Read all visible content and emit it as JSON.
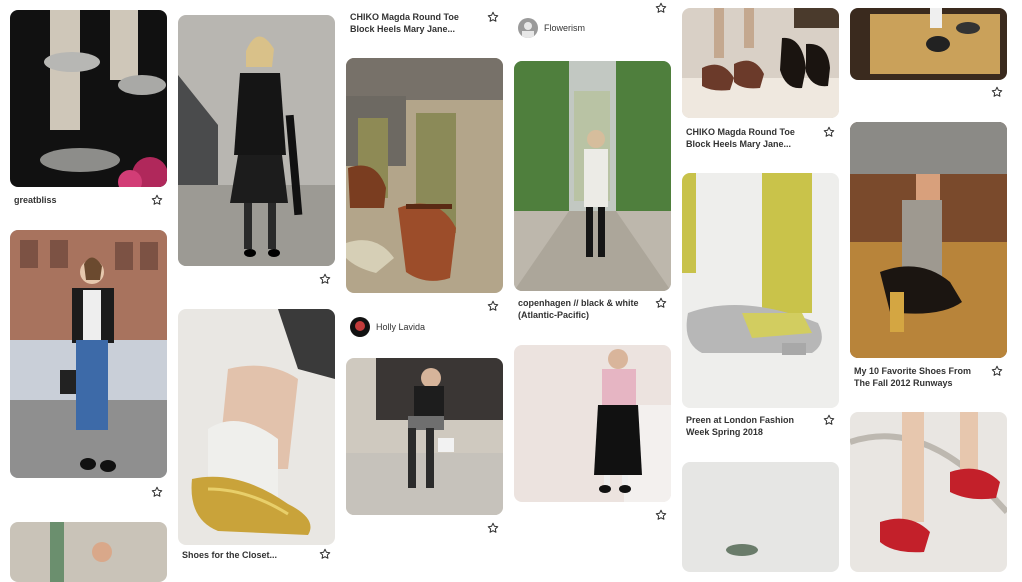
{
  "pins": {
    "c1": {
      "p1": {
        "caption_l1": "greatbliss"
      },
      "p2": {},
      "p3": {}
    },
    "c2": {
      "p1": {},
      "p2": {
        "caption_l1": "Shoes for the Closet..."
      }
    },
    "c3": {
      "p1": {
        "caption_l1": "CHIKO Magda Round Toe",
        "caption_l2": "Block Heels Mary Jane..."
      },
      "p2": {},
      "author": {
        "name": "Holly Lavida"
      },
      "p3": {}
    },
    "c4": {
      "author": {
        "name": "Flowerism"
      },
      "p1": {
        "caption_l1": "copenhagen // black & white",
        "caption_l2": "(Atlantic-Pacific)"
      },
      "p2": {}
    },
    "c5": {
      "p1": {
        "caption_l1": "CHIKO Magda Round Toe",
        "caption_l2": "Block Heels Mary Jane..."
      },
      "p2": {
        "caption_l1": "Preen at London Fashion",
        "caption_l2": "Week Spring 2018"
      },
      "p3": {}
    },
    "c6": {
      "p1": {},
      "p2": {
        "caption_l1": "My 10 Favorite Shoes From",
        "caption_l2": "The Fall 2012 Runways"
      },
      "p3": {}
    }
  },
  "icons": {
    "save": "star-outline-icon"
  },
  "colors": {
    "background": "#ffffff",
    "text": "#333333",
    "star": "#333333"
  }
}
